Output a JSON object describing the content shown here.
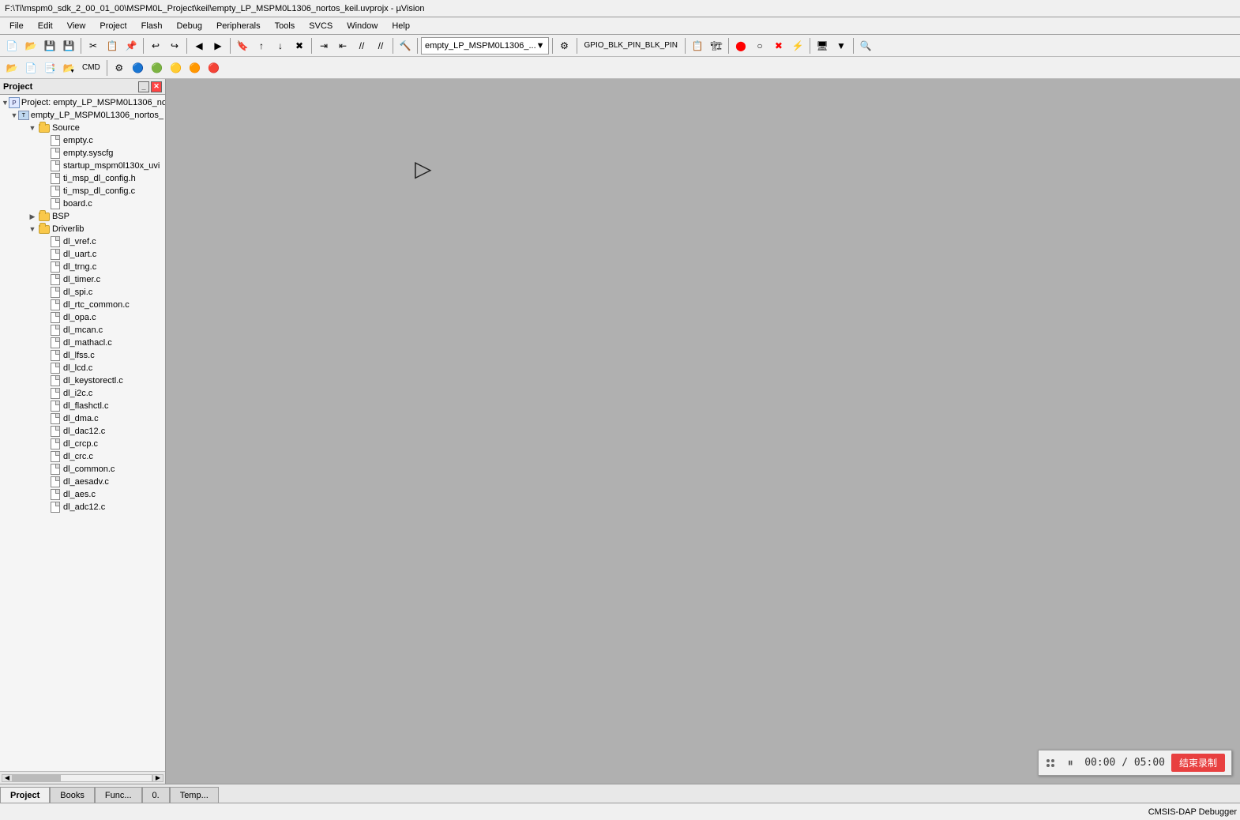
{
  "titlebar": {
    "text": "F:\\Ti\\mspm0_sdk_2_00_01_00\\MSPM0L_Project\\keil\\empty_LP_MSPM0L1306_nortos_keil.uvprojx - µVision"
  },
  "menubar": {
    "items": [
      "File",
      "Edit",
      "View",
      "Project",
      "Flash",
      "Debug",
      "Peripherals",
      "Tools",
      "SVCS",
      "Window",
      "Help"
    ]
  },
  "toolbar1": {
    "dropdown_label": "empty_LP_MSPM0L1306_...",
    "gpio_btn": "GPIO_BLK_PIN_BLK_PIN"
  },
  "toolbar2": {
    "items": []
  },
  "project_panel": {
    "title": "Project",
    "root_project": "Project: empty_LP_MSPM0L1306_no",
    "root_target": "empty_LP_MSPM0L1306_nortos_",
    "groups": [
      {
        "name": "Source",
        "expanded": true,
        "files": [
          "empty.c",
          "empty.syscfg",
          "startup_mspm0l130x_uvi",
          "ti_msp_dl_config.h",
          "ti_msp_dl_config.c",
          "board.c"
        ]
      },
      {
        "name": "BSP",
        "expanded": false,
        "files": []
      },
      {
        "name": "Driverlib",
        "expanded": true,
        "files": [
          "dl_vref.c",
          "dl_uart.c",
          "dl_trng.c",
          "dl_timer.c",
          "dl_spi.c",
          "dl_rtc_common.c",
          "dl_opa.c",
          "dl_mcan.c",
          "dl_mathacl.c",
          "dl_lfss.c",
          "dl_lcd.c",
          "dl_keystorectl.c",
          "dl_i2c.c",
          "dl_flashctl.c",
          "dl_dma.c",
          "dl_dac12.c",
          "dl_crcp.c",
          "dl_crc.c",
          "dl_common.c",
          "dl_aesadv.c",
          "dl_aes.c",
          "dl_adc12.c"
        ]
      }
    ]
  },
  "bottom_tabs": {
    "items": [
      "Project",
      "Books",
      "Func...",
      "0.",
      "Temp..."
    ]
  },
  "statusbar": {
    "debugger": "CMSIS-DAP Debugger"
  },
  "timer_widget": {
    "time_display": "00:00 / 05:00",
    "stop_btn_label": "结束录制"
  },
  "icons": {
    "folder": "📁",
    "file": "📄",
    "project": "🗂"
  }
}
